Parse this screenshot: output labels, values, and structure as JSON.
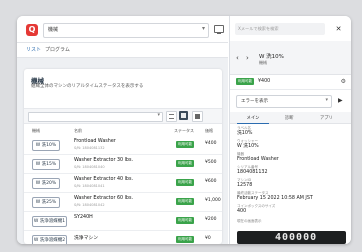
{
  "header": {
    "logo_text": "Q",
    "machine_select_value": "機械",
    "icon": "monitor-icon"
  },
  "nav": {
    "tabs": [
      {
        "label": "リスト"
      },
      {
        "label": "プログラム"
      }
    ]
  },
  "machines": {
    "title": "機械",
    "subtitle": "組織全体のマシンのリアルタイムステータスを表示する",
    "filter_value": "",
    "view_icons": [
      "list-view-icon",
      "grid-view-icon",
      "tile-view-icon"
    ],
    "columns": [
      "機械",
      "名前",
      "ステータス",
      "価格"
    ],
    "rows": [
      {
        "tag": "W 洗10%",
        "name": "Frontload Washer",
        "serial": "S/N: 1804081132",
        "status": "利用可能",
        "price": "¥400"
      },
      {
        "tag": "W 洗15%",
        "name": "Washer Extractor 30 lbs.",
        "serial": "S/N: 1804081040",
        "status": "利用可能",
        "price": "¥500"
      },
      {
        "tag": "W 洗20%",
        "name": "Washer Extractor 40 lbs.",
        "serial": "S/N: 1804081041",
        "status": "利用可能",
        "price": "¥600"
      },
      {
        "tag": "W 洗25%",
        "name": "Washer Extractor 60 lbs.",
        "serial": "S/N: 1804081042",
        "status": "利用可能",
        "price": "¥1,000"
      },
      {
        "tag": "W 洗浄溶媒機1",
        "name": "SY240H",
        "serial": "",
        "status": "利用可能",
        "price": "¥200"
      },
      {
        "tag": "W 洗浄溶媒機2",
        "name": "洗浄マシン",
        "serial": "",
        "status": "利用可能",
        "price": "¥0"
      }
    ]
  },
  "detail": {
    "search_placeholder": "Xメールで検索を検索",
    "close_label": "✕",
    "title": "W 洗10%",
    "subtitle": "機械",
    "status": "利用可能",
    "status_value": "¥400",
    "error_select": "エラーを表示",
    "tabs": [
      {
        "label": "メイン"
      },
      {
        "label": "診断"
      },
      {
        "label": "アプリ"
      }
    ],
    "fields": [
      {
        "label": "ラベル名",
        "value": "洗10%"
      },
      {
        "label": "ウォッシャー",
        "value": "W 洗10%"
      },
      {
        "label": "機器",
        "value": "Frontload Washer"
      },
      {
        "label": "シリアル番号",
        "value": "1804081132"
      },
      {
        "label": "マシンID",
        "value": "12578"
      },
      {
        "label": "最終活動ステータス",
        "value": "February 15 2022 10:58 AM JST"
      },
      {
        "label": "コインボックスのサイズ",
        "value": "400"
      },
      {
        "label": "現在の画面表示",
        "value": ""
      }
    ],
    "display_readout": "400000"
  }
}
